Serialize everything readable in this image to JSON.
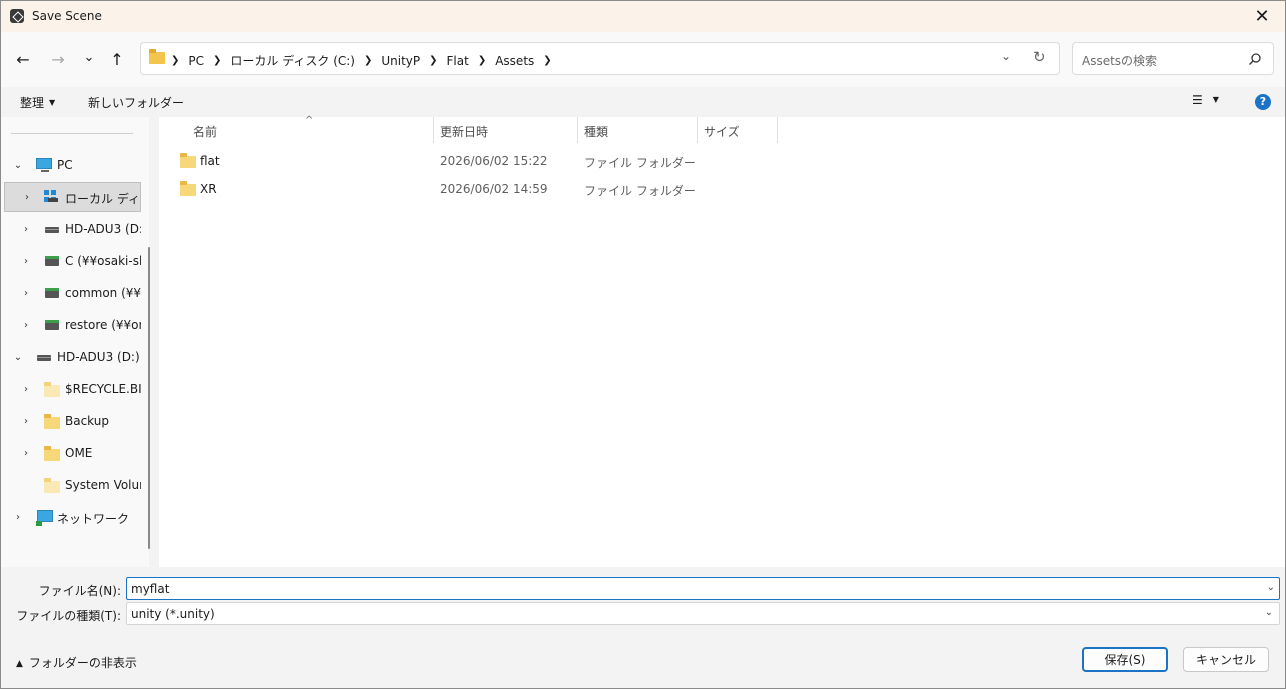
{
  "window": {
    "title": "Save Scene",
    "close_glyph": "✕"
  },
  "nav": {
    "back_glyph": "←",
    "forward_glyph": "→",
    "recent_glyph": "⌄",
    "up_glyph": "↑",
    "breadcrumbs": [
      "PC",
      "ローカル ディスク (C:)",
      "UnityP",
      "Flat",
      "Assets"
    ],
    "dropdown_glyph": "⌄",
    "refresh_glyph": "↻",
    "search_placeholder": "Assetsの検索"
  },
  "commandbar": {
    "organize_label": "整理",
    "new_folder_label": "新しいフォルダー",
    "view_glyph": "☰",
    "help_glyph": "?"
  },
  "navpane": {
    "items": [
      {
        "label": "PC",
        "icon": "pc-icon",
        "expanded": true
      },
      {
        "label": "ローカル ディスク",
        "icon": "windows-drive-icon",
        "selected": true
      },
      {
        "label": "HD-ADU3 (D:)",
        "icon": "drive-icon"
      },
      {
        "label": "C (¥¥osaki-sho",
        "icon": "network-drive-icon"
      },
      {
        "label": "common (¥¥on",
        "icon": "network-drive-icon"
      },
      {
        "label": "restore (¥¥ona",
        "icon": "network-drive-icon"
      },
      {
        "label": "HD-ADU3 (D:)",
        "icon": "drive-icon",
        "expanded": true
      },
      {
        "label": "$RECYCLE.BIN",
        "icon": "folder-icon"
      },
      {
        "label": "Backup",
        "icon": "folder-icon"
      },
      {
        "label": "OME",
        "icon": "folder-icon"
      },
      {
        "label": "System Volume",
        "icon": "folder-icon"
      },
      {
        "label": "ネットワーク",
        "icon": "network-icon"
      }
    ]
  },
  "filelist": {
    "columns": [
      "名前",
      "更新日時",
      "種類",
      "サイズ"
    ],
    "sort_glyph": "^",
    "rows": [
      {
        "name": "flat",
        "date": "2026/06/02 15:22",
        "type": "ファイル フォルダー"
      },
      {
        "name": "XR",
        "date": "2026/06/02 14:59",
        "type": "ファイル フォルダー"
      }
    ]
  },
  "fields": {
    "filename_label": "ファイル名(N):",
    "filename_value": "myflat",
    "filetype_label": "ファイルの種類(T):",
    "filetype_value": "unity (*.unity)"
  },
  "footer": {
    "hide_folders_label": "フォルダーの非表示",
    "save_label": "保存(S)",
    "cancel_label": "キャンセル"
  },
  "colors": {
    "accent": "#1a73c7",
    "titlebar": "#fbf3ea",
    "folder": "#f6d77a"
  }
}
